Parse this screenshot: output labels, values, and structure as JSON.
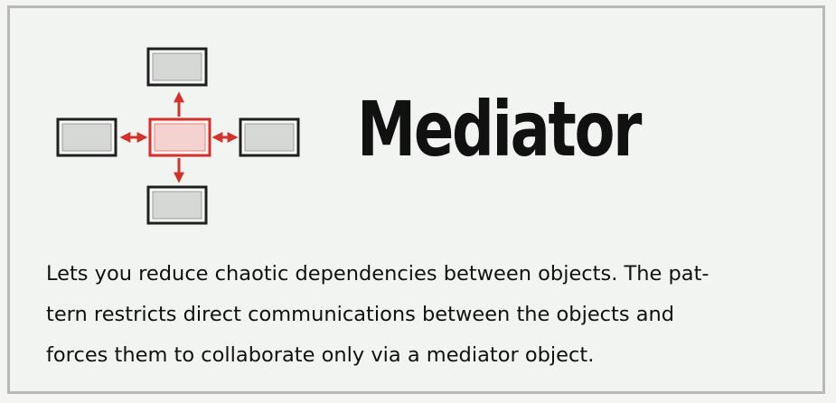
{
  "card": {
    "title": "Mediator",
    "description_lines": [
      "Lets you reduce chaotic dependencies between objects. The pat-",
      "tern restricts direct communications between the objects and",
      "forces them to collaborate only via a mediator object."
    ]
  },
  "colors": {
    "accent_red": "#d3312a",
    "box_border": "#1f1f1f",
    "box_fill": "#d6d8d5",
    "card_border": "#b7b9b6"
  },
  "icons": {
    "diagram": "mediator-diagram-icon"
  }
}
